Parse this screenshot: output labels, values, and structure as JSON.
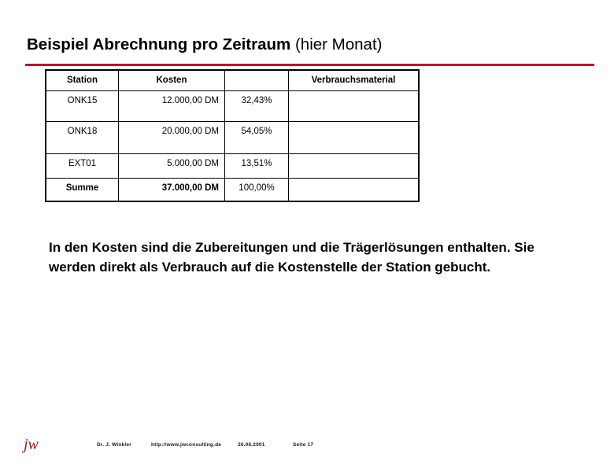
{
  "slide": {
    "title_bold": "Beispiel Abrechnung pro Zeitraum",
    "title_light": "(hier Monat)",
    "rule_color": "#C0102A"
  },
  "table": {
    "headers": [
      "Station",
      "Kosten",
      "",
      "Verbrauchsmaterial"
    ],
    "rows": [
      {
        "station": "ONK15",
        "kosten": "12.000,00 DM",
        "anteil": "32,43%",
        "verbrauchsmaterial": ""
      },
      {
        "station": "ONK18",
        "kosten": "20.000,00 DM",
        "anteil": "54,05%",
        "verbrauchsmaterial": ""
      },
      {
        "station": "EXT01",
        "kosten": "5.000,00 DM",
        "anteil": "13,51%",
        "verbrauchsmaterial": ""
      },
      {
        "station": "Summe",
        "kosten": "37.000,00 DM",
        "anteil": "100,00%",
        "verbrauchsmaterial": ""
      }
    ]
  },
  "body": {
    "paragraph": "In den Kosten sind die Zubereitungen und  die Trägerlösungen enthalten. Sie werden direkt als Verbrauch auf die Kostenstelle der Station gebucht."
  },
  "footer": {
    "logo": "jw",
    "logo_color": "#9B1B23",
    "author": "Dr. J. Winkler",
    "url": "http://www.jwconsulting.de",
    "date": "26.06.2001",
    "page": "Seite 17"
  }
}
